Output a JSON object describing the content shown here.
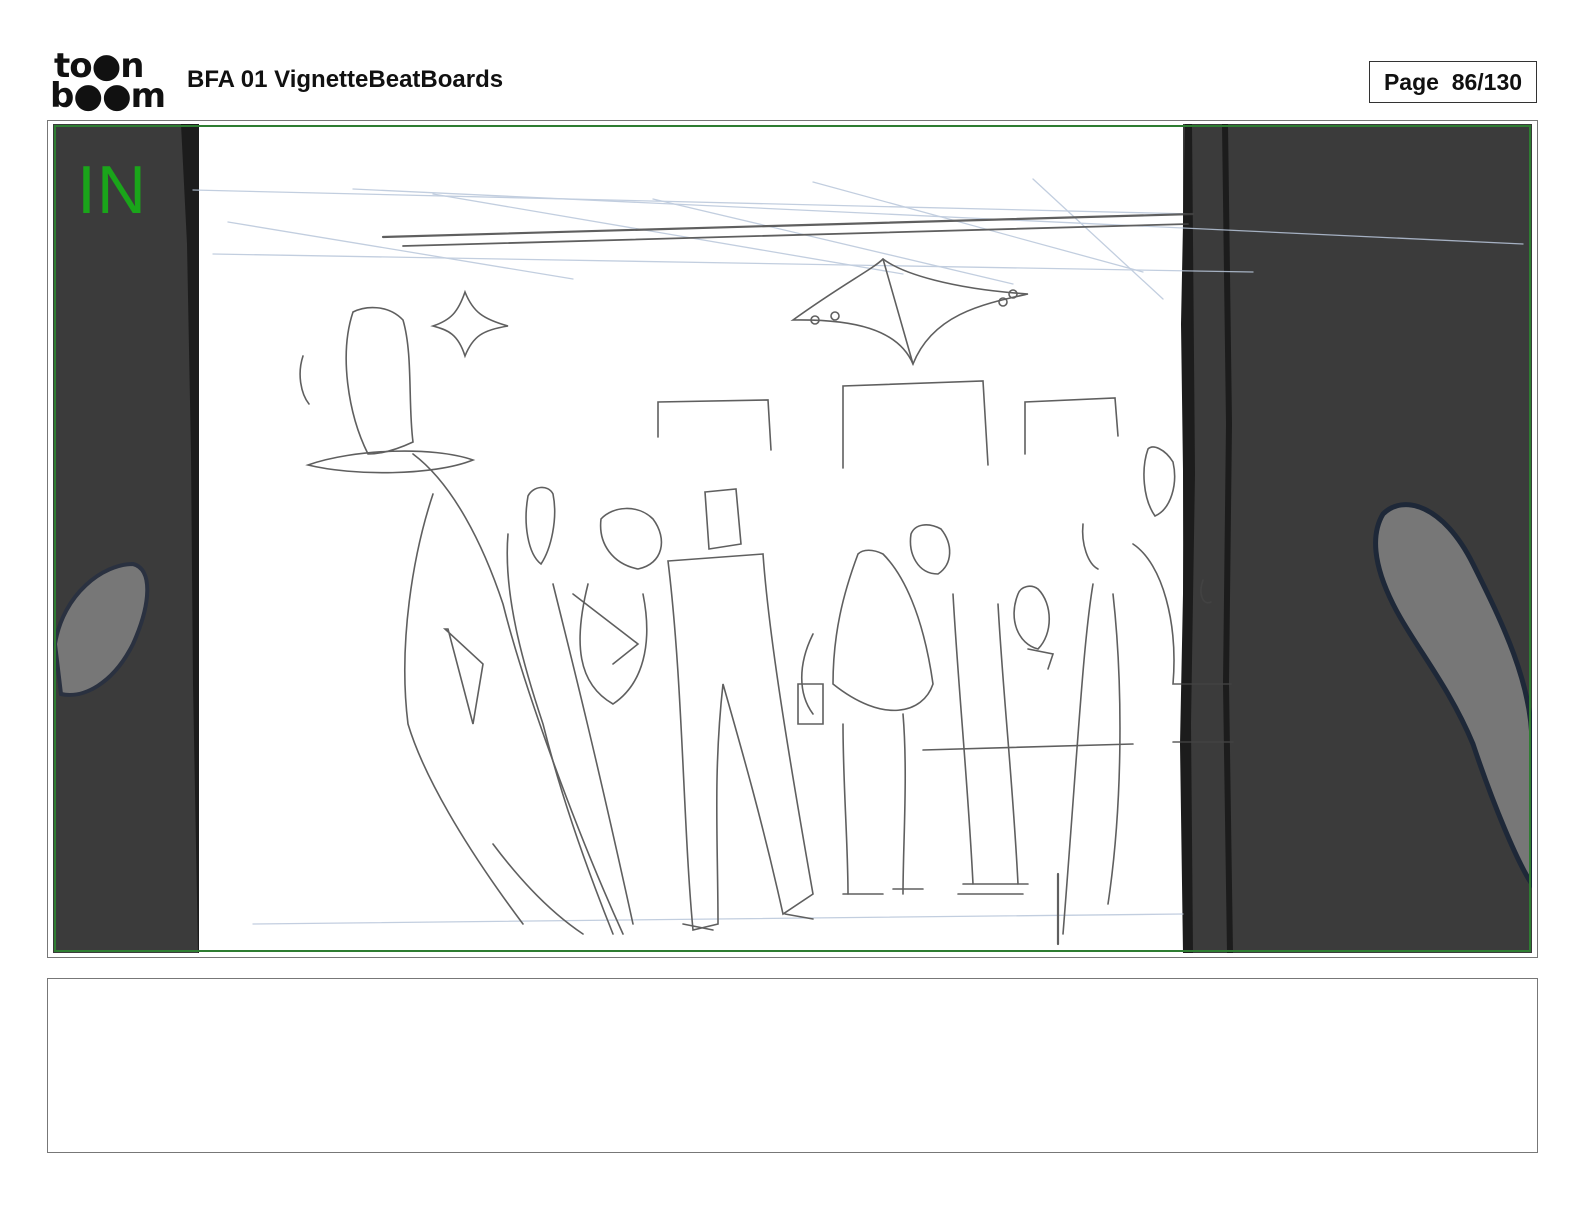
{
  "header": {
    "logo_top": "to●n",
    "logo_bottom": "b●●m",
    "document_title": "BFA 01 VignetteBeatBoards",
    "page_indicator": "Page  86/130"
  },
  "panel": {
    "transition_label": "IN",
    "label_color": "#1aa51a",
    "border_color": "#2e7d32",
    "mask_color": "#3b3b3b",
    "sketch_color": "#444444"
  },
  "notes": {
    "text": ""
  }
}
